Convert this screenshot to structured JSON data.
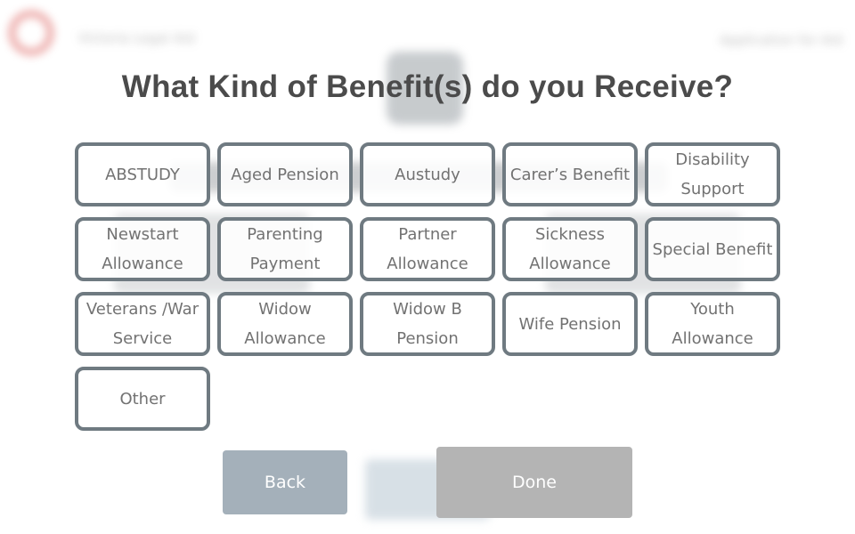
{
  "background": {
    "logo_text": "Victoria Legal Aid",
    "header_right": "Application for Aid"
  },
  "title": "What Kind of Benefit(s) do you Receive?",
  "options": [
    {
      "line1": "ABSTUDY",
      "line2": ""
    },
    {
      "line1": "Aged Pension",
      "line2": ""
    },
    {
      "line1": "Austudy",
      "line2": ""
    },
    {
      "line1": "Carer’s Benefit",
      "line2": ""
    },
    {
      "line1": "Disability",
      "line2": "Support"
    },
    {
      "line1": "Newstart",
      "line2": "Allowance"
    },
    {
      "line1": "Parenting",
      "line2": "Payment"
    },
    {
      "line1": "Partner",
      "line2": "Allowance"
    },
    {
      "line1": "Sickness",
      "line2": "Allowance"
    },
    {
      "line1": "Special Benefit",
      "line2": ""
    },
    {
      "line1": "Veterans /War",
      "line2": "Service"
    },
    {
      "line1": "Widow",
      "line2": "Allowance"
    },
    {
      "line1": "Widow B",
      "line2": "Pension"
    },
    {
      "line1": "Wife Pension",
      "line2": ""
    },
    {
      "line1": "Youth",
      "line2": "Allowance"
    },
    {
      "line1": "Other",
      "line2": ""
    }
  ],
  "buttons": {
    "back": "Back",
    "done": "Done"
  },
  "colors": {
    "option_border": "#6f7a81",
    "back_button": "#a4b0ba",
    "done_button": "#b4b4b4",
    "logo": "#d9534f"
  }
}
